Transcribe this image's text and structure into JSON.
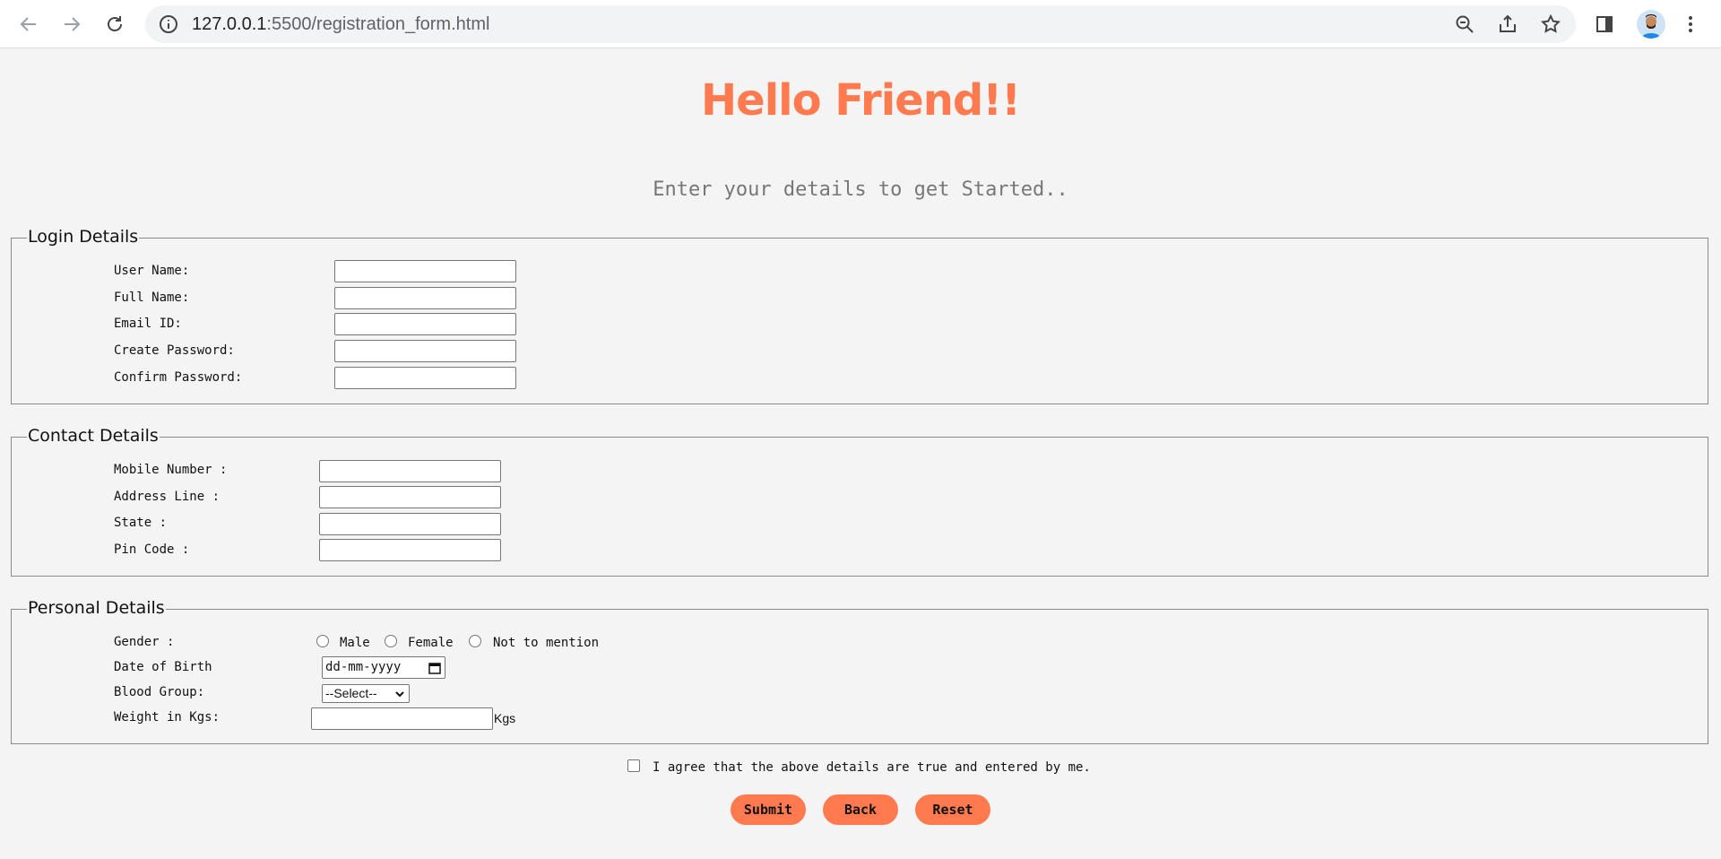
{
  "browser": {
    "url_host": "127.0.0.1",
    "url_rest": ":5500/registration_form.html"
  },
  "page": {
    "title": "Hello Friend!!",
    "subtitle": "Enter your details to get Started.."
  },
  "login": {
    "legend": "Login Details",
    "labels": [
      "User Name:",
      "Full Name:",
      "Email ID:",
      "Create Password:",
      "Confirm Password:"
    ]
  },
  "contact": {
    "legend": "Contact Details",
    "labels": [
      "Mobile Number :",
      "Address Line :",
      "State :",
      "Pin Code :"
    ]
  },
  "personal": {
    "legend": "Personal Details",
    "gender_label": "Gender :",
    "gender_options": [
      "Male",
      "Female",
      "Not to mention"
    ],
    "dob_label": "Date of Birth",
    "dob_placeholder": "dd-mm-yyyy",
    "blood_label": "Blood Group:",
    "blood_selected": "--Select--",
    "weight_label": "Weight in Kgs:",
    "weight_unit": "Kgs"
  },
  "agreement": "I agree that the above details are true and entered by me.",
  "buttons": {
    "submit": "Submit",
    "back": "Back",
    "reset": "Reset"
  },
  "colors": {
    "accent": "#ff7b4f",
    "background": "#f4f4f4"
  }
}
